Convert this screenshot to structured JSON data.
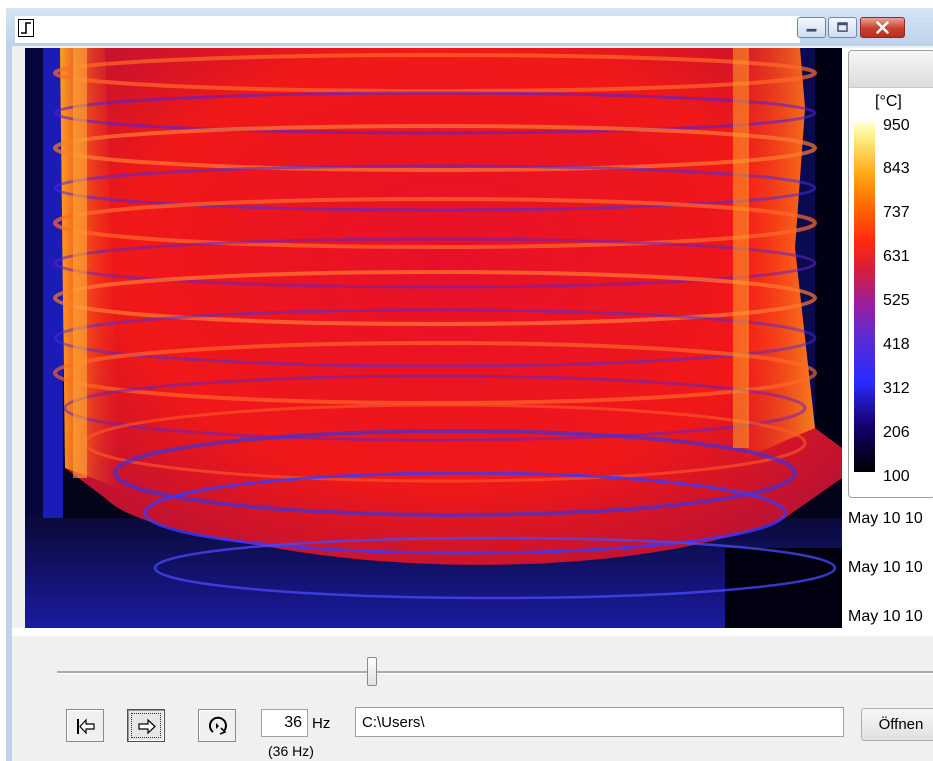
{
  "window": {
    "title": "",
    "controls": [
      "minimize",
      "maximize",
      "close"
    ]
  },
  "colorbar": {
    "unit": "[°C]",
    "ticks": [
      "950",
      "843",
      "737",
      "631",
      "525",
      "418",
      "312",
      "206",
      "100"
    ],
    "min": 100,
    "max": 950
  },
  "time_labels": [
    "May 10 10",
    "May 10 10",
    "May 10 10"
  ],
  "playback": {
    "slider_position": 0.36,
    "buttons": [
      "rewind-to-start-icon",
      "play-forward-icon",
      "loop-icon"
    ],
    "frequency_value": "36",
    "frequency_unit": "Hz",
    "frequency_note": "(36 Hz)"
  },
  "file": {
    "path": "C:\\Users\\",
    "open_label": "Öffnen"
  },
  "colors": {
    "frame": "#bfd3ea",
    "close_button": "#c8412f",
    "thermal_hot": "#ff6a00",
    "thermal_mid": "#ff1e1e",
    "thermal_cold": "#2a2bff"
  }
}
